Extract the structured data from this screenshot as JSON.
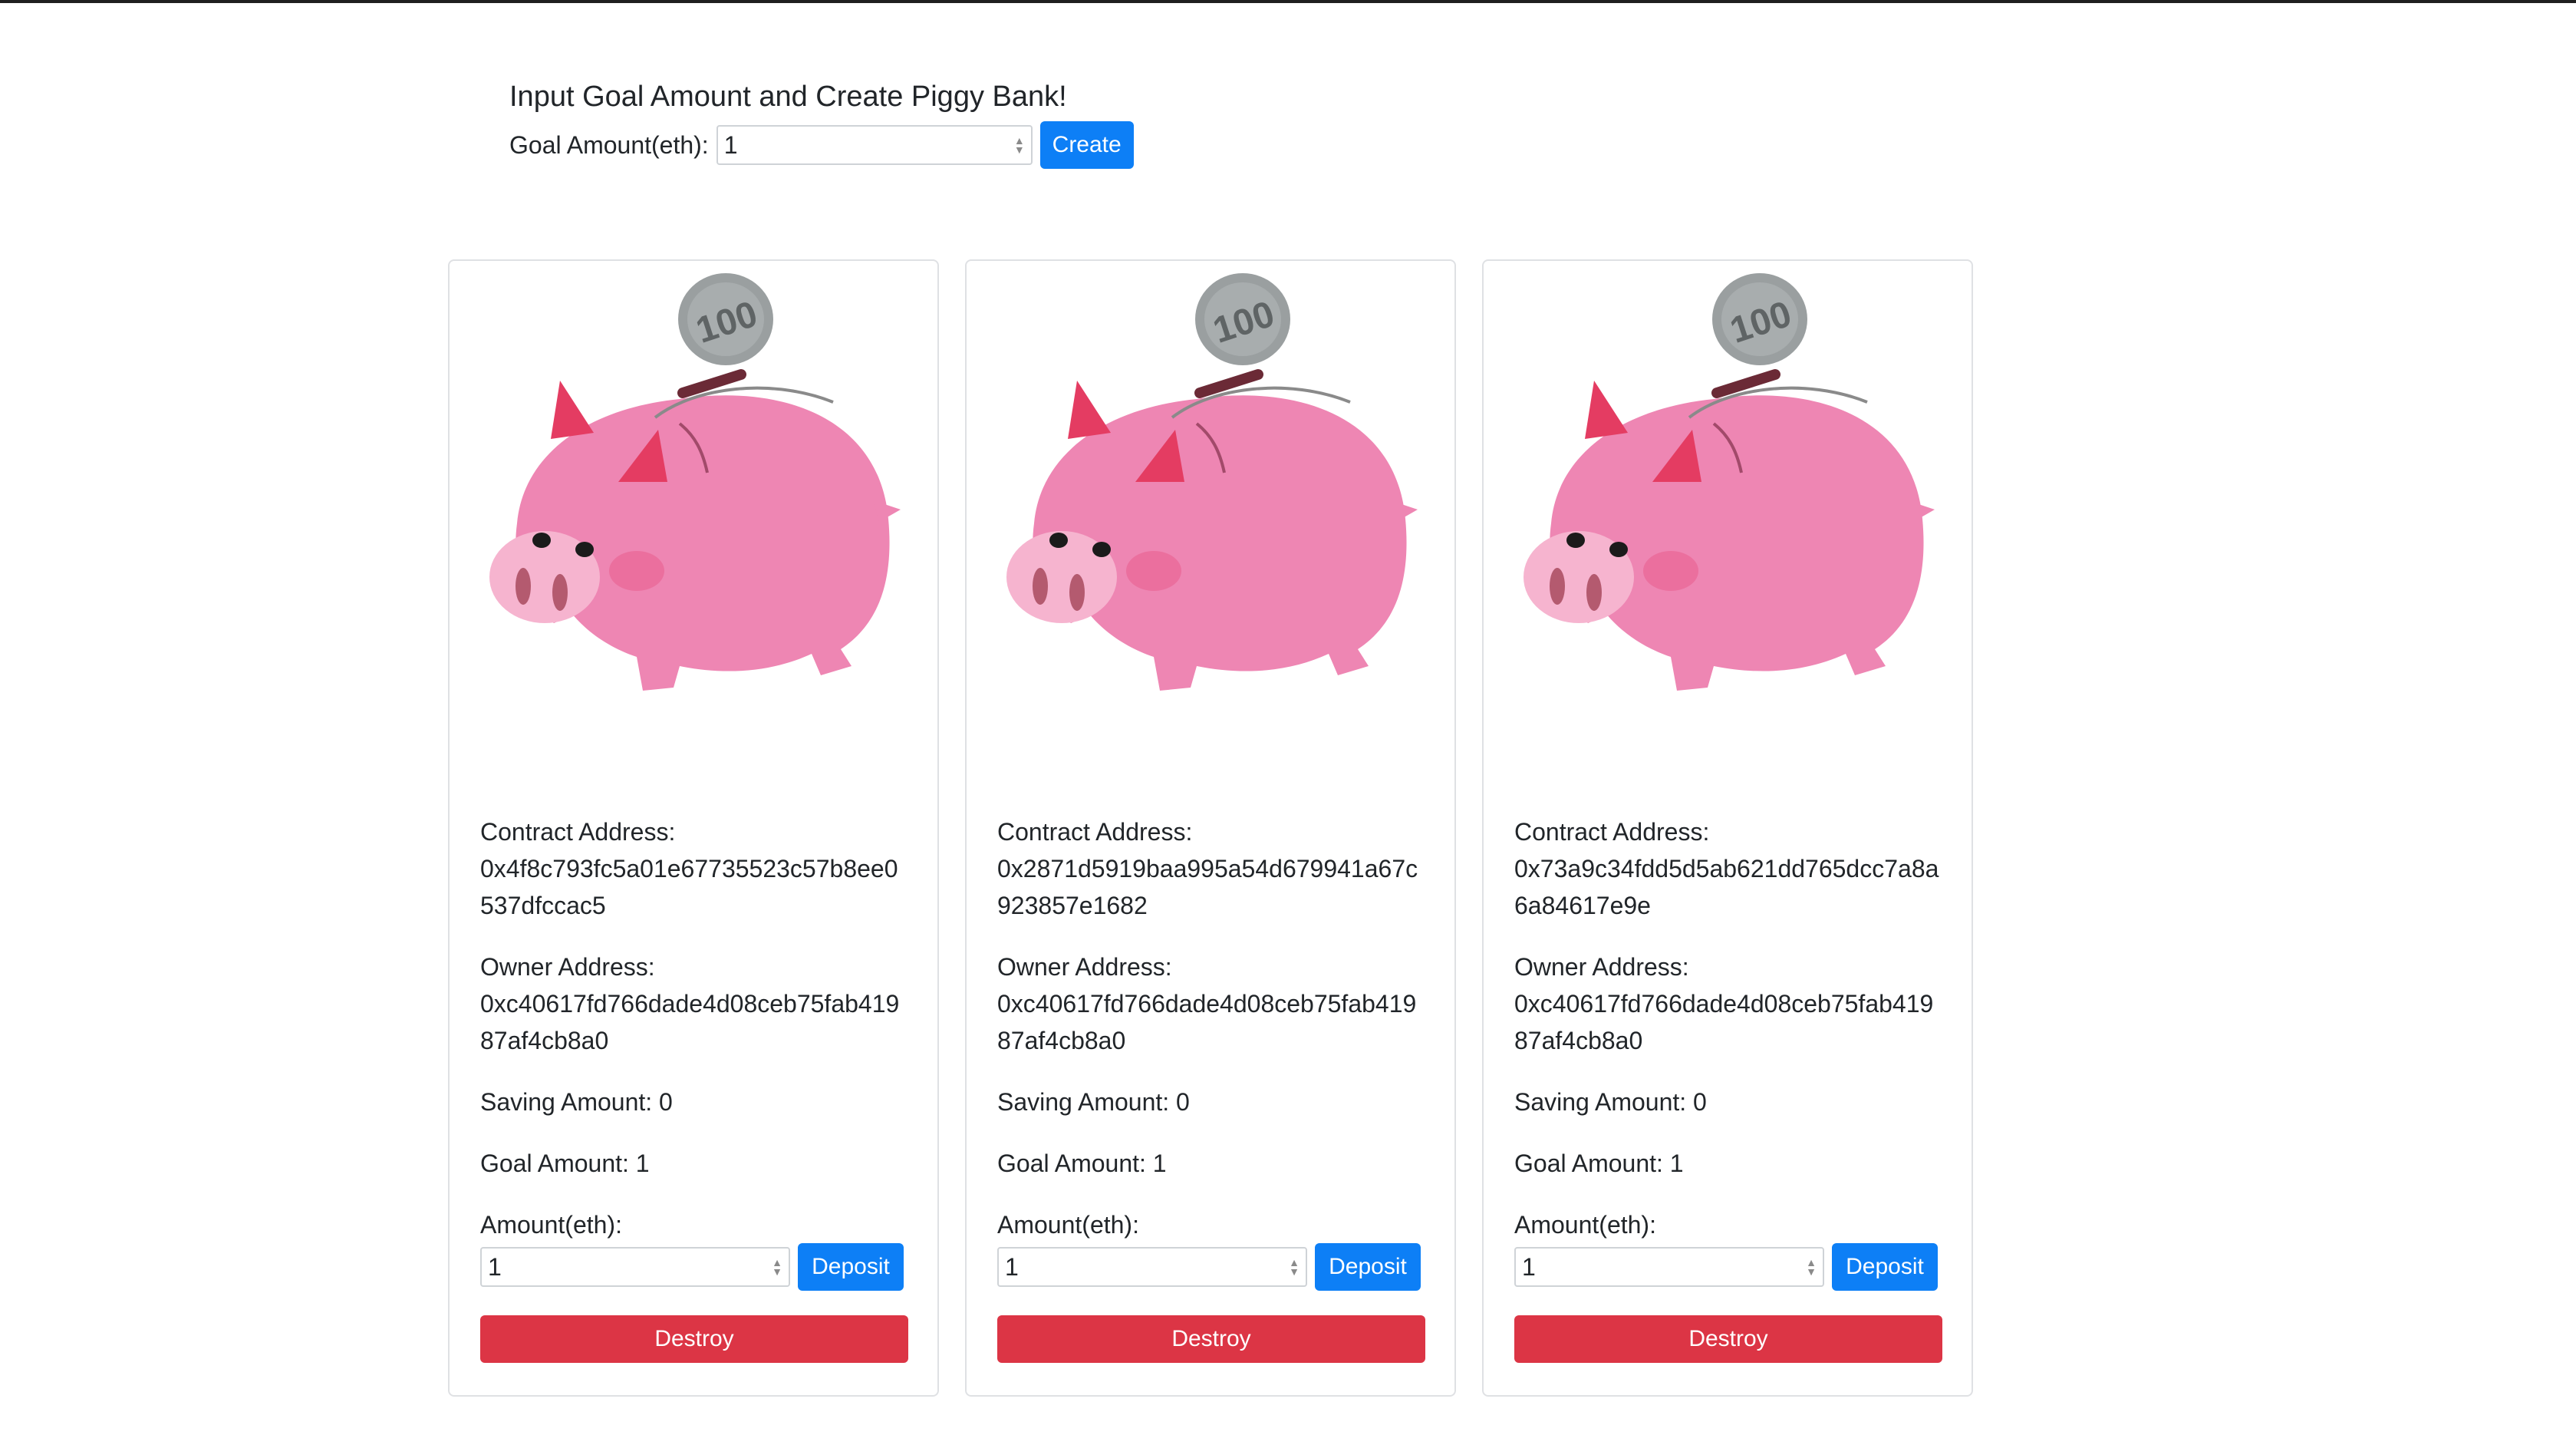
{
  "create": {
    "title": "Input Goal Amount and Create Piggy Bank!",
    "goal_label": "Goal Amount(eth):",
    "goal_value": "1",
    "create_label": "Create"
  },
  "cards": [
    {
      "coin_text": "100",
      "contract_label": "Contract Address:",
      "contract_address": "0x4f8c793fc5a01e67735523c57b8ee0537dfccac5",
      "owner_label": "Owner Address:",
      "owner_address": "0xc40617fd766dade4d08ceb75fab41987af4cb8a0",
      "saving_text": "Saving Amount: 0",
      "goal_text": "Goal Amount: 1",
      "amount_label": "Amount(eth):",
      "amount_value": "1",
      "deposit_label": "Deposit",
      "destroy_label": "Destroy"
    },
    {
      "coin_text": "100",
      "contract_label": "Contract Address:",
      "contract_address": "0x2871d5919baa995a54d679941a67c923857e1682",
      "owner_label": "Owner Address:",
      "owner_address": "0xc40617fd766dade4d08ceb75fab41987af4cb8a0",
      "saving_text": "Saving Amount: 0",
      "goal_text": "Goal Amount: 1",
      "amount_label": "Amount(eth):",
      "amount_value": "1",
      "deposit_label": "Deposit",
      "destroy_label": "Destroy"
    },
    {
      "coin_text": "100",
      "contract_label": "Contract Address:",
      "contract_address": "0x73a9c34fdd5d5ab621dd765dcc7a8a6a84617e9e",
      "owner_label": "Owner Address:",
      "owner_address": "0xc40617fd766dade4d08ceb75fab41987af4cb8a0",
      "saving_text": "Saving Amount: 0",
      "goal_text": "Goal Amount: 1",
      "amount_label": "Amount(eth):",
      "amount_value": "1",
      "deposit_label": "Deposit",
      "destroy_label": "Destroy"
    }
  ],
  "colors": {
    "primary": "#0d7ff6",
    "danger": "#dc3545",
    "pig_body": "#ee86b3",
    "pig_snout": "#f6b4cf",
    "coin": "#9a9fa0"
  },
  "icons": {
    "coin": "coin-100-icon",
    "pig": "piggy-bank-icon",
    "spinner": "number-spinner-icon"
  }
}
